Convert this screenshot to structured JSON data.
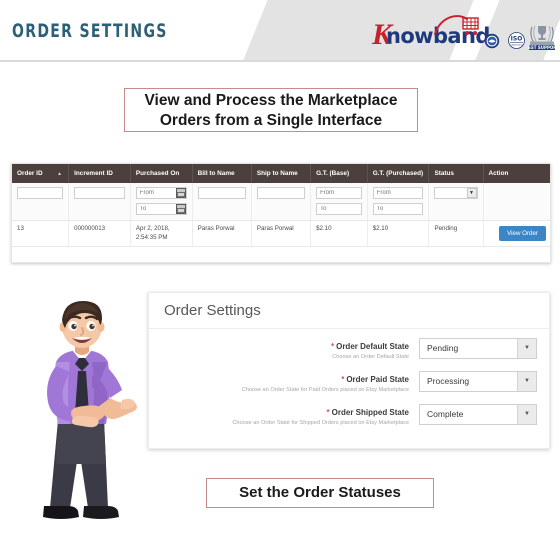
{
  "header": {
    "title": "ORDER SETTINGS",
    "brand": {
      "letter": "K",
      "word": "nowband",
      "cart_icon": "shopping-cart-icon"
    },
    "badges": [
      {
        "name": "certification-seal-badge",
        "label": ""
      },
      {
        "name": "iso-badge",
        "label": "ISO"
      },
      {
        "name": "best-support-badge",
        "label": "BEST SUPPORT"
      }
    ]
  },
  "callouts": {
    "top_line1": "View and Process the Marketplace",
    "top_line2": "Orders from a Single Interface",
    "bottom": "Set the Order Statuses"
  },
  "orders_table": {
    "columns": [
      "Order ID",
      "Increment ID",
      "Purchased On",
      "Bill to Name",
      "Ship to Name",
      "G.T. (Base)",
      "G.T. (Purchased)",
      "Status",
      "Action"
    ],
    "sort_indicator_column": "Order ID",
    "filters": {
      "order_id": "",
      "increment_id": "",
      "purchased_on_from": "From",
      "purchased_on_to": "To",
      "bill_to_name": "",
      "ship_to_name": "",
      "gt_base_from": "From",
      "gt_base_to": "To",
      "gt_purchased_from": "From",
      "gt_purchased_to": "To",
      "status": ""
    },
    "rows": [
      {
        "order_id": "13",
        "increment_id": "000000013",
        "purchased_on_date": "Apr 2, 2018,",
        "purchased_on_time": "2:54:35 PM",
        "bill_to_name": "Paras Porwal",
        "ship_to_name": "Paras Porwal",
        "gt_base": "$2.10",
        "gt_purchased": "$2.10",
        "status": "Pending",
        "action_label": "View Order"
      }
    ]
  },
  "settings": {
    "title": "Order Settings",
    "fields": [
      {
        "label": "Order Default State",
        "hint": "Choose an Order Default State",
        "value": "Pending",
        "required": "*"
      },
      {
        "label": "Order Paid State",
        "hint": "Choose an Order State for Paid Orders placed on Etsy Marketplace",
        "value": "Processing",
        "required": "*"
      },
      {
        "label": "Order Shipped State",
        "hint": "Choose an Order State for Shipped Orders placed on Etsy Marketplace",
        "value": "Complete",
        "required": "*"
      }
    ]
  },
  "mascot": {
    "name": "businessman-mascot-illustration",
    "shirt_color": "#a077d6",
    "pants_color": "#3a3b47",
    "tie_color": "#2e2f3a"
  },
  "colors": {
    "title_teal": "#2b6077",
    "brand_navy": "#1e3a7b",
    "brand_red": "#c8202c",
    "table_header_brown": "#4b403b",
    "primary_button_blue": "#3d86c6",
    "callout_border": "#c98a8a",
    "required_red": "#d9534f"
  }
}
